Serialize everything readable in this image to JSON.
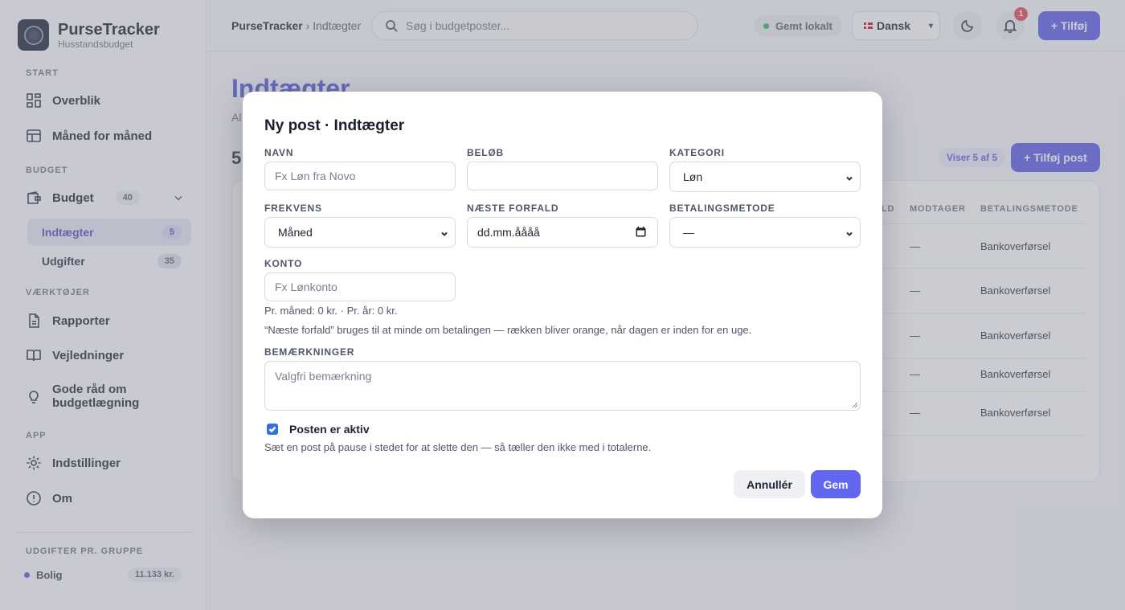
{
  "app": {
    "name": "PurseTracker",
    "subtitle": "Husstandsbudget"
  },
  "sidebar": {
    "sections": {
      "start": "START",
      "budget": "BUDGET",
      "tools": "VÆRKTØJER",
      "app": "APP",
      "groups": "UDGIFTER PR. GRUPPE"
    },
    "overview": "Overblik",
    "monthly": "Måned for måned",
    "budget": {
      "label": "Budget",
      "count": "40"
    },
    "income": {
      "label": "Indtægter",
      "count": "5"
    },
    "expenses": {
      "label": "Udgifter",
      "count": "35"
    },
    "reports": "Rapporter",
    "guides": "Vejledninger",
    "tips": "Gode råd om budgetlægning",
    "settings": "Indstillinger",
    "about": "Om",
    "group": {
      "label": "Bolig",
      "amount": "11.133 kr.",
      "color": "#5b5ce0"
    }
  },
  "topbar": {
    "crumb_root": "PurseTracker",
    "crumb_sep": " › ",
    "crumb_current": "Indtægter",
    "search_placeholder": "Søg i budgetposter...",
    "saved": "Gemt lokalt",
    "language": "Dansk",
    "notifications": "1",
    "add": "+ Tilføj"
  },
  "main": {
    "title": "Indtægter",
    "subtitle": "Al",
    "count": "5",
    "showing": "Viser 5 af 5",
    "add_post": "+ Tilføj post",
    "columns": {
      "c1": "LD",
      "recipient": "MODTAGER",
      "method": "BETALINGSMETODE"
    },
    "rows": [
      {
        "recipient": "—",
        "method": "Bankoverførsel"
      },
      {
        "recipient": "—",
        "method": "Bankoverførsel"
      },
      {
        "recipient": "—",
        "method": "Bankoverførsel"
      },
      {
        "recipient": "—",
        "method": "Bankoverførsel"
      },
      {
        "recipient": "—",
        "method": "Bankoverførsel"
      }
    ]
  },
  "modal": {
    "title": "Ny post · Indtægter",
    "name": {
      "label": "NAVN",
      "placeholder": "Fx Løn fra Novo"
    },
    "amount": {
      "label": "BELØB",
      "value": ""
    },
    "category": {
      "label": "KATEGORI",
      "value": "Løn"
    },
    "frequency": {
      "label": "FREKVENS",
      "value": "Måned"
    },
    "next_due": {
      "label": "NÆSTE FORFALD",
      "placeholder": "dd.mm.åååå"
    },
    "payment": {
      "label": "BETALINGSMETODE",
      "value": "—"
    },
    "account": {
      "label": "KONTO",
      "placeholder": "Fx Lønkonto"
    },
    "totals": "Pr. måned: 0 kr. · Pr. år: 0 kr.",
    "due_hint": "“Næste forfald” bruges til at minde om betalingen — rækken bliver orange, når dagen er inden for en uge.",
    "notes": {
      "label": "BEMÆRKNINGER",
      "placeholder": "Valgfri bemærkning"
    },
    "active": {
      "label": "Posten er aktiv",
      "checked": true
    },
    "active_hint": "Sæt en post på pause i stedet for at slette den — så tæller den ikke med i totalerne.",
    "cancel": "Annullér",
    "save": "Gem"
  }
}
